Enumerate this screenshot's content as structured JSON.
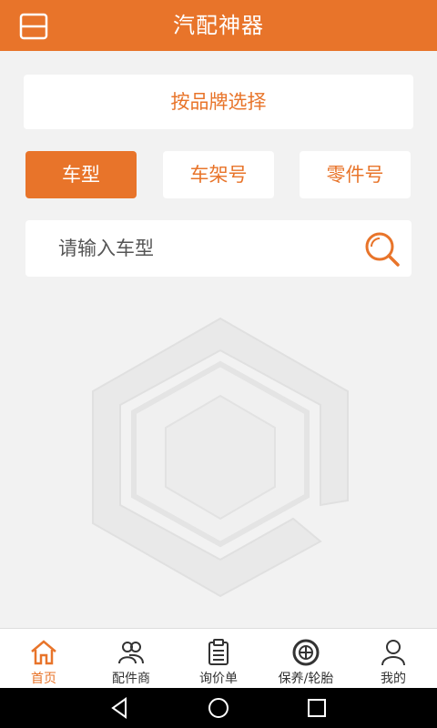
{
  "header": {
    "title": "汽配神器",
    "menu_icon": "menu-icon"
  },
  "brand_select": {
    "label": "按品牌选择"
  },
  "tabs": [
    {
      "label": "车型",
      "active": true
    },
    {
      "label": "车架号",
      "active": false
    },
    {
      "label": "零件号",
      "active": false
    }
  ],
  "search": {
    "placeholder": "请输入车型",
    "value": "",
    "icon": "search-icon"
  },
  "bottom_nav": [
    {
      "label": "首页",
      "icon": "home-icon",
      "active": true
    },
    {
      "label": "配件商",
      "icon": "users-icon",
      "active": false
    },
    {
      "label": "询价单",
      "icon": "clipboard-icon",
      "active": false
    },
    {
      "label": "保养/轮胎",
      "icon": "tire-icon",
      "active": false
    },
    {
      "label": "我的",
      "icon": "user-icon",
      "active": false
    }
  ],
  "colors": {
    "accent": "#e8742a",
    "background": "#f2f2f2"
  }
}
